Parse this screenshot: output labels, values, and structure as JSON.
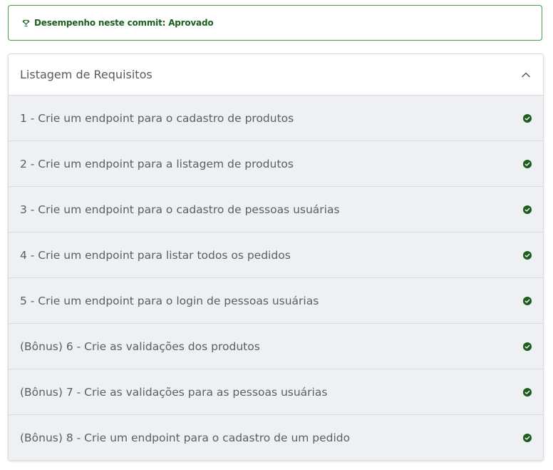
{
  "status_banner": {
    "icon": "trophy-icon",
    "text": "Desempenho neste commit: Aprovado",
    "border_color": "#43a047",
    "text_color": "#1b5e20"
  },
  "requirements_panel": {
    "title": "Listagem de Requisitos",
    "expanded": true,
    "toggle_icon": "chevron-up-icon",
    "items": [
      {
        "label": "1 - Crie um endpoint para o cadastro de produtos",
        "status": "passed"
      },
      {
        "label": "2 - Crie um endpoint para a listagem de produtos",
        "status": "passed"
      },
      {
        "label": "3 - Crie um endpoint para o cadastro de pessoas usuárias",
        "status": "passed"
      },
      {
        "label": "4 - Crie um endpoint para listar todos os pedidos",
        "status": "passed"
      },
      {
        "label": "5 - Crie um endpoint para o login de pessoas usuárias",
        "status": "passed"
      },
      {
        "label": "(Bônus) 6 - Crie as validações dos produtos",
        "status": "passed"
      },
      {
        "label": "(Bônus) 7 - Crie as validações para as pessoas usuárias",
        "status": "passed"
      },
      {
        "label": "(Bônus) 8 - Crie um endpoint para o cadastro de um pedido",
        "status": "passed"
      }
    ],
    "passed_icon": "check-circle-icon",
    "passed_color": "#1b5e20"
  }
}
